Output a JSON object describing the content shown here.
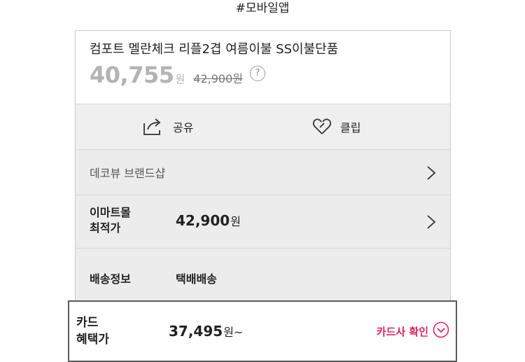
{
  "caption": "#모바일앱",
  "product": {
    "name": "컴포트 멜란체크 리플2겹 여름이불 SS이불단품",
    "sale_price": "40,755",
    "sale_unit": "원",
    "original_price": "42,900원",
    "help_symbol": "?"
  },
  "actions": {
    "share_label": "공유",
    "clip_label": "클립"
  },
  "brand": {
    "label": "데코뷰 브랜드샵"
  },
  "emart": {
    "label_line1": "이마트몰",
    "label_line2": "최적가",
    "price": "42,900",
    "unit": "원"
  },
  "shipping": {
    "label": "배송정보",
    "value": "택배배송"
  },
  "card": {
    "label_line1": "카드",
    "label_line2": "혜택가",
    "price": "37,495",
    "unit": "원~",
    "check_label": "카드사 확인"
  },
  "colors": {
    "accent_pink": "#e0245e",
    "panel_bg": "#ececec",
    "muted_price": "#b3b3b3"
  },
  "icons": {
    "share": "share-icon",
    "clip": "heart-clip-icon",
    "chevron": "chevron-right-icon",
    "help": "question-circle-icon",
    "dropdown": "chevron-down-circle-icon"
  }
}
